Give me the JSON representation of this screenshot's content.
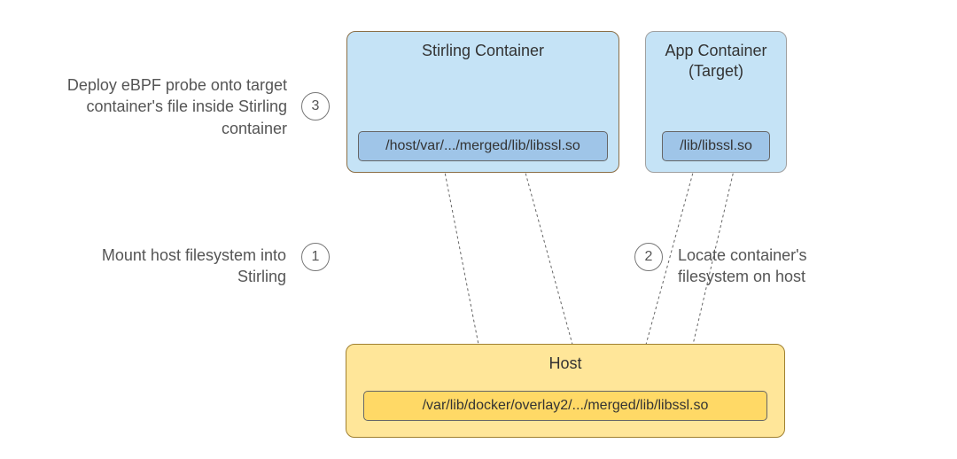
{
  "boxes": {
    "stirling": {
      "title": "Stirling Container",
      "path": "/host/var/.../merged/lib/libssl.so"
    },
    "app": {
      "titleLine1": "App Container",
      "titleLine2": "(Target)",
      "path": "/lib/libssl.so"
    },
    "host": {
      "title": "Host",
      "path": "/var/lib/docker/overlay2/.../merged/lib/libssl.so"
    }
  },
  "steps": {
    "s1": {
      "num": "1",
      "text": "Mount host filesystem into Stirling"
    },
    "s2": {
      "num": "2",
      "text": "Locate container's filesystem on host"
    },
    "s3": {
      "num": "3",
      "text": "Deploy eBPF probe onto target container's file inside Stirling container"
    }
  },
  "chart_data": {
    "type": "diagram",
    "nodes": [
      {
        "id": "stirling",
        "label": "Stirling Container",
        "items": [
          "/host/var/.../merged/lib/libssl.so"
        ]
      },
      {
        "id": "app",
        "label": "App Container (Target)",
        "items": [
          "/lib/libssl.so"
        ]
      },
      {
        "id": "host",
        "label": "Host",
        "items": [
          "/var/lib/docker/overlay2/.../merged/lib/libssl.so"
        ]
      }
    ],
    "steps": [
      {
        "order": 1,
        "from": "host",
        "to": "stirling",
        "label": "Mount host filesystem into Stirling"
      },
      {
        "order": 2,
        "from": "app",
        "to": "host",
        "label": "Locate container's filesystem on host"
      },
      {
        "order": 3,
        "at": "stirling",
        "label": "Deploy eBPF probe onto target container's file inside Stirling container"
      }
    ]
  }
}
